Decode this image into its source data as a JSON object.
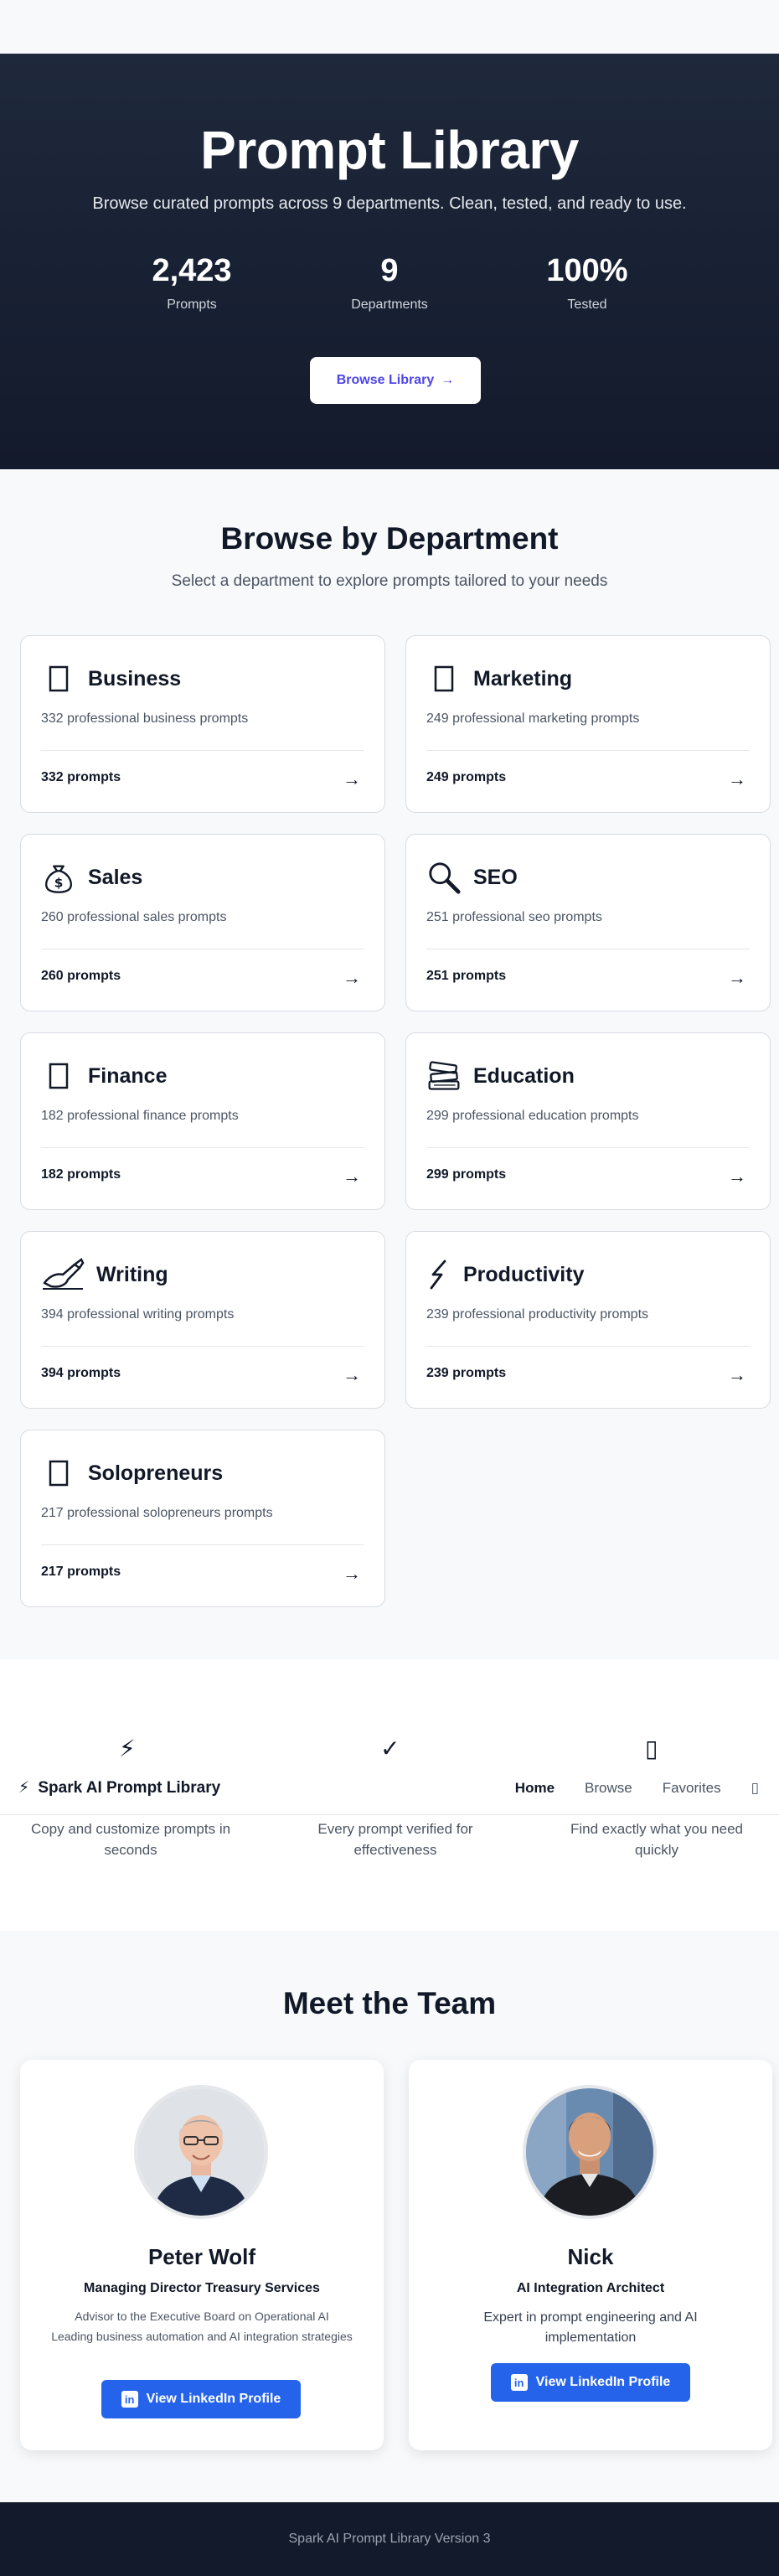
{
  "hero": {
    "title": "Prompt Library",
    "subtitle": "Browse curated prompts across 9 departments. Clean, tested, and ready to use.",
    "stats": [
      {
        "value": "2,423",
        "label": "Prompts"
      },
      {
        "value": "9",
        "label": "Departments"
      },
      {
        "value": "100%",
        "label": "Tested"
      }
    ],
    "button_label": "Browse Library",
    "button_arrow": "→"
  },
  "departments": {
    "title": "Browse by Department",
    "subtitle": "Select a department to explore prompts tailored to your needs",
    "cards": [
      {
        "name": "Business",
        "icon": "briefcase-icon",
        "desc": "332 professional business prompts",
        "count": "332 prompts"
      },
      {
        "name": "Marketing",
        "icon": "megaphone-icon",
        "desc": "249 professional marketing prompts",
        "count": "249 prompts"
      },
      {
        "name": "Sales",
        "icon": "money-bag-icon",
        "desc": "260 professional sales prompts",
        "count": "260 prompts"
      },
      {
        "name": "SEO",
        "icon": "magnifier-icon",
        "desc": "251 professional seo prompts",
        "count": "251 prompts"
      },
      {
        "name": "Finance",
        "icon": "chart-icon",
        "desc": "182 professional finance prompts",
        "count": "182 prompts"
      },
      {
        "name": "Education",
        "icon": "books-icon",
        "desc": "299 professional education prompts",
        "count": "299 prompts"
      },
      {
        "name": "Writing",
        "icon": "writing-hand-icon",
        "desc": "394 professional writing prompts",
        "count": "394 prompts"
      },
      {
        "name": "Productivity",
        "icon": "lightning-icon",
        "desc": "239 professional productivity prompts",
        "count": "239 prompts"
      },
      {
        "name": "Solopreneurs",
        "icon": "rocket-icon",
        "desc": "217 professional solopreneurs prompts",
        "count": "217 prompts"
      }
    ],
    "arrow": "→"
  },
  "features": [
    {
      "icon": "lightning-icon",
      "glyph": "⚡",
      "text": "Copy and customize prompts in seconds"
    },
    {
      "icon": "checkmark-icon",
      "glyph": "✓",
      "text": "Every prompt verified for effectiveness"
    },
    {
      "icon": "search-icon",
      "glyph": "▯",
      "text": "Find exactly what you need quickly"
    }
  ],
  "nav": {
    "brand_icon": "lightning-icon",
    "brand_glyph": "⚡",
    "brand": "Spark AI Prompt Library",
    "links": [
      "Home",
      "Browse",
      "Favorites"
    ],
    "theme_icon": "theme-toggle-icon",
    "theme_glyph": "▯"
  },
  "team": {
    "title": "Meet the Team",
    "members": [
      {
        "name": "Peter Wolf",
        "role": "Managing Director Treasury Services",
        "line1": "Advisor to the Executive Board on Operational AI",
        "line2": "Leading business automation and AI integration strategies",
        "button": "View LinkedIn Profile"
      },
      {
        "name": "Nick",
        "role": "AI Integration Architect",
        "line1": "Expert in prompt engineering and AI implementation",
        "button": "View LinkedIn Profile"
      }
    ],
    "linkedin_glyph": "in"
  },
  "footer": {
    "text": "Spark AI Prompt Library Version 3"
  },
  "colors": {
    "hero_bg": "#1e293b",
    "accent": "#4f46e5",
    "linkedin": "#2563eb",
    "footer_bg": "#131a2c"
  }
}
